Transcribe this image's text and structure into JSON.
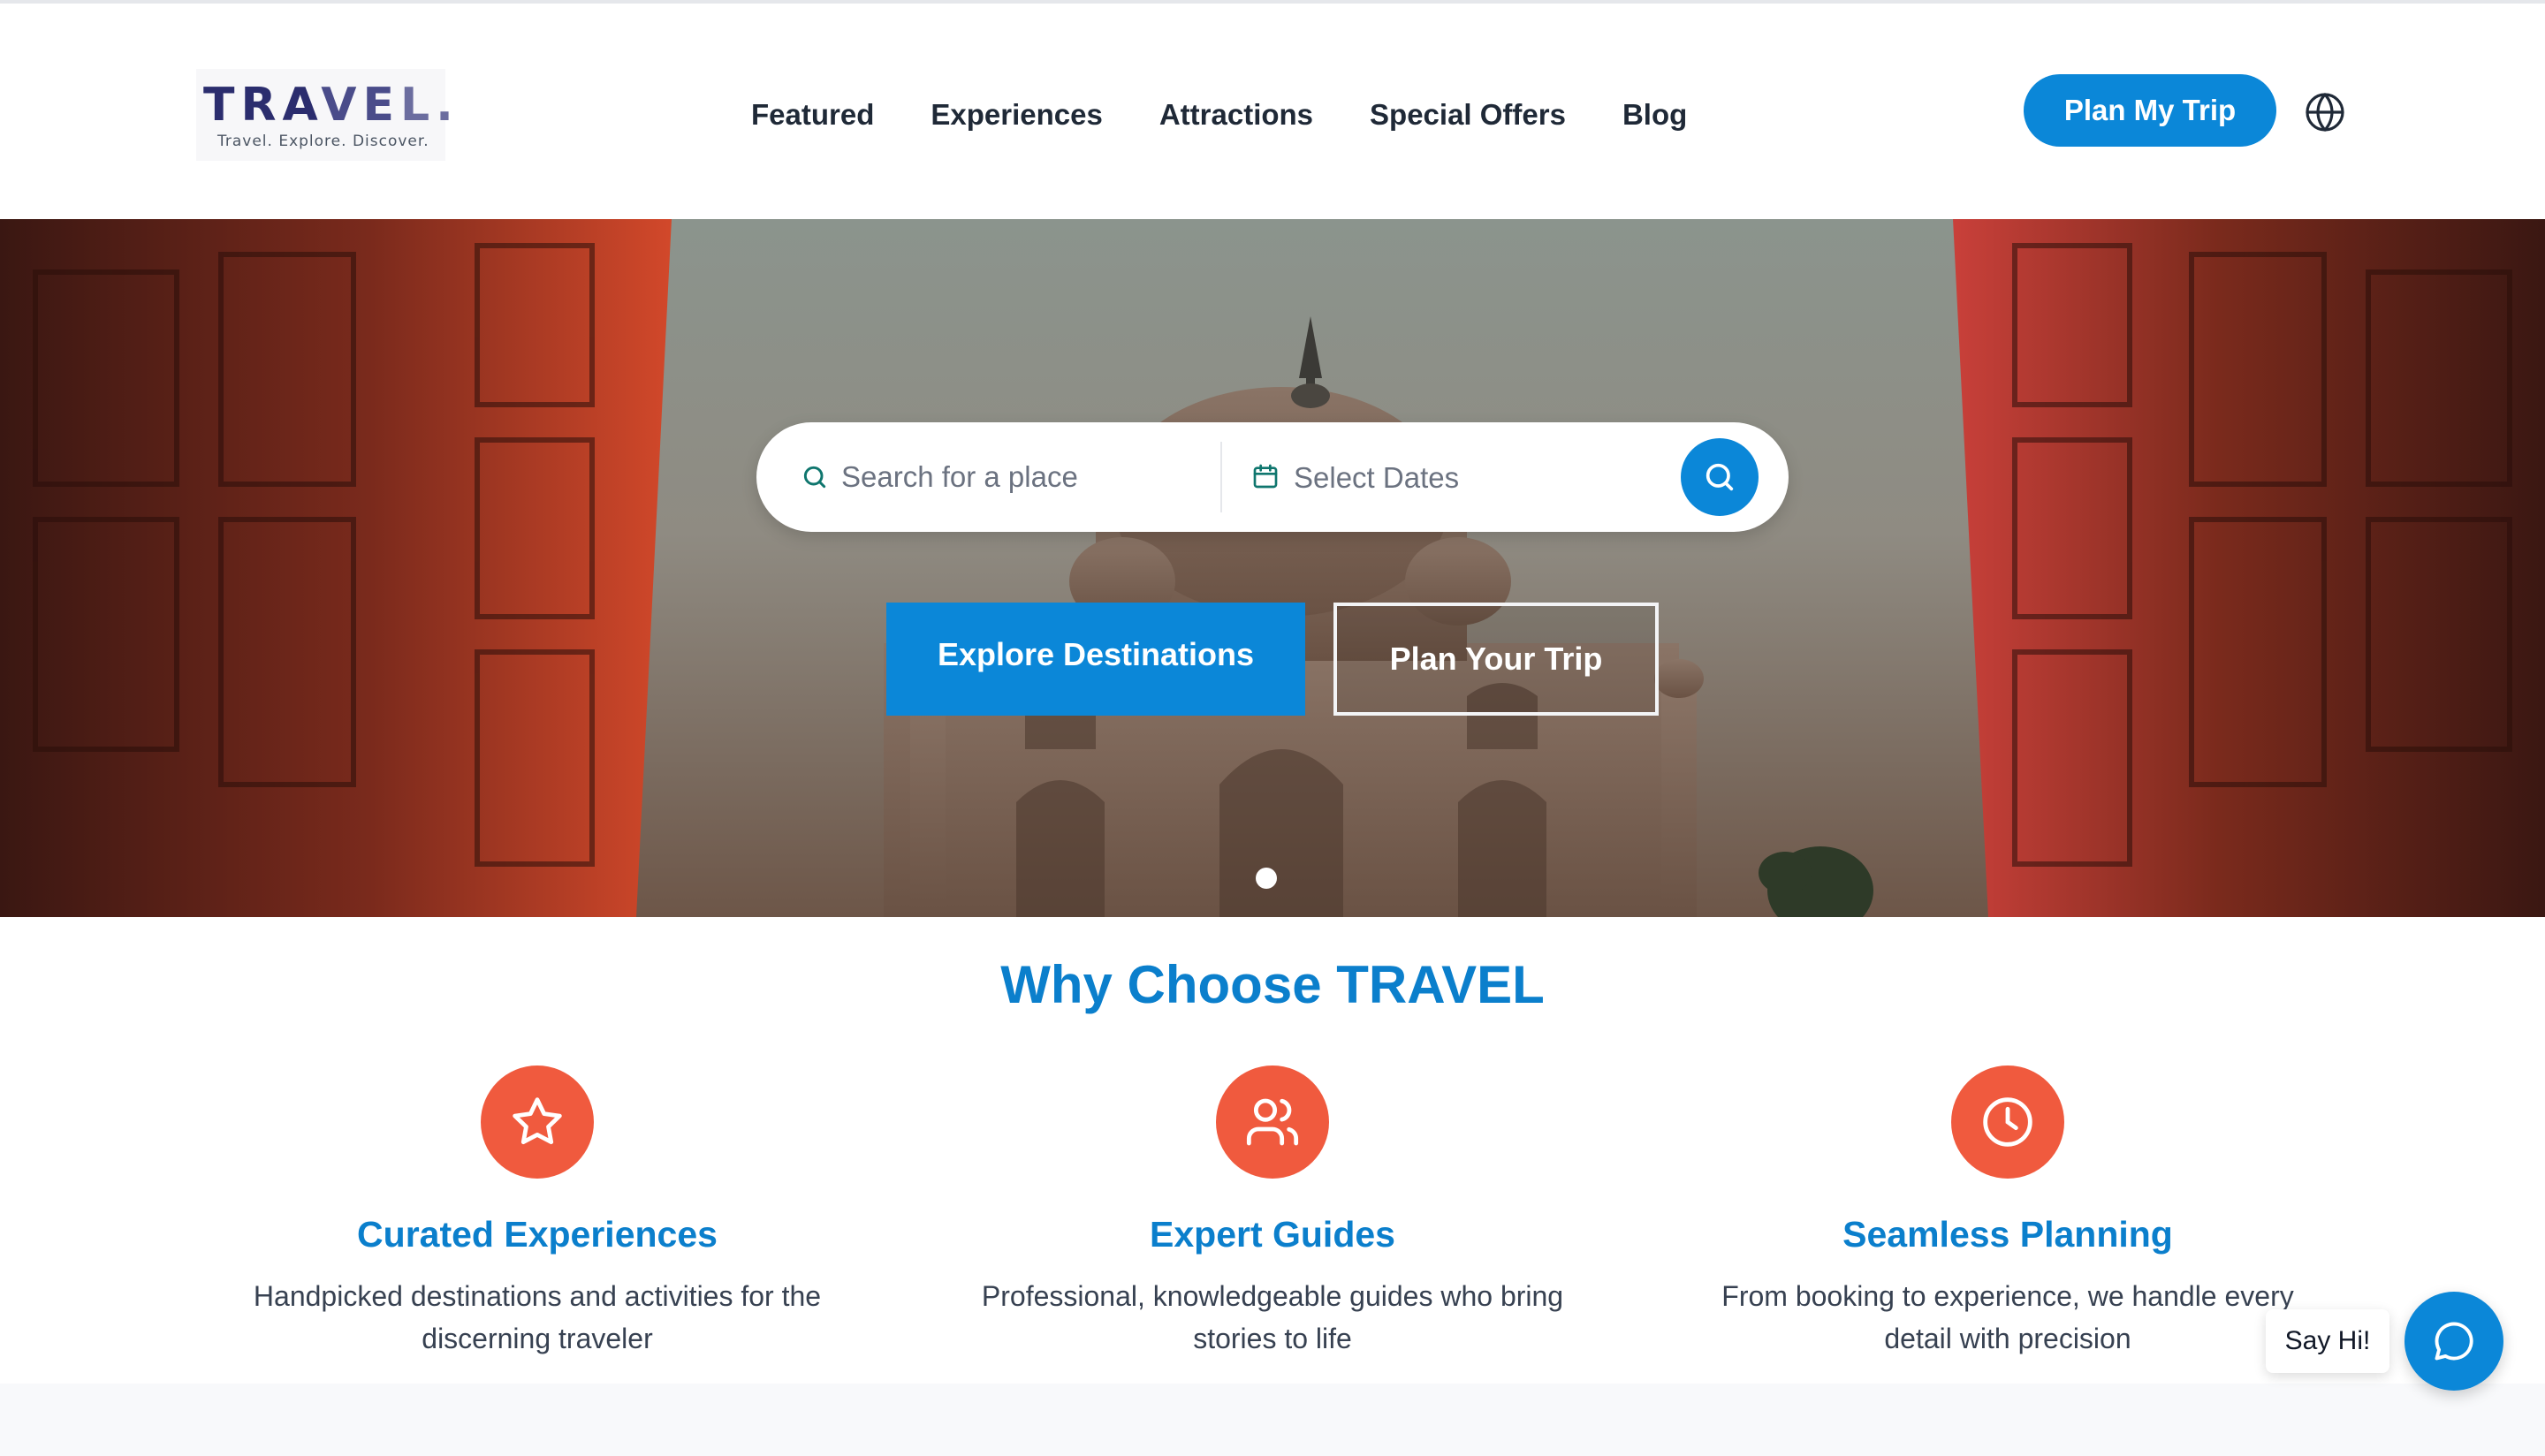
{
  "brand": {
    "wordmark_a": "TRA",
    "wordmark_b": "VE",
    "wordmark_c": "L.",
    "tagline": "Travel. Explore. Discover."
  },
  "nav": {
    "items": [
      {
        "label": "Featured"
      },
      {
        "label": "Experiences"
      },
      {
        "label": "Attractions"
      },
      {
        "label": "Special Offers"
      },
      {
        "label": "Blog"
      }
    ],
    "cta_label": "Plan My Trip",
    "language_icon": "globe-icon"
  },
  "hero": {
    "search": {
      "place_placeholder": "Search for a place",
      "place_value": "",
      "dates_label": "Select Dates",
      "search_icon": "search-icon",
      "calendar_icon": "calendar-icon"
    },
    "primary_cta": "Explore Destinations",
    "secondary_cta": "Plan Your Trip",
    "slides": {
      "total": 1,
      "active": 1
    }
  },
  "why": {
    "title": "Why Choose TRAVEL",
    "features": [
      {
        "icon": "star-icon",
        "title": "Curated Experiences",
        "desc": "Handpicked destinations and activities for the discerning traveler"
      },
      {
        "icon": "users-icon",
        "title": "Expert Guides",
        "desc": "Professional, knowledgeable guides who bring stories to life"
      },
      {
        "icon": "clock-icon",
        "title": "Seamless Planning",
        "desc": "From booking to experience, we handle every detail with precision"
      }
    ]
  },
  "chat": {
    "greeting": "Say Hi!",
    "icon": "chat-bubble-icon"
  },
  "colors": {
    "primary": "#0b87d8",
    "heading": "#0b7fcc",
    "accent": "#f05a3e",
    "brand_navy": "#2b2d6e"
  }
}
